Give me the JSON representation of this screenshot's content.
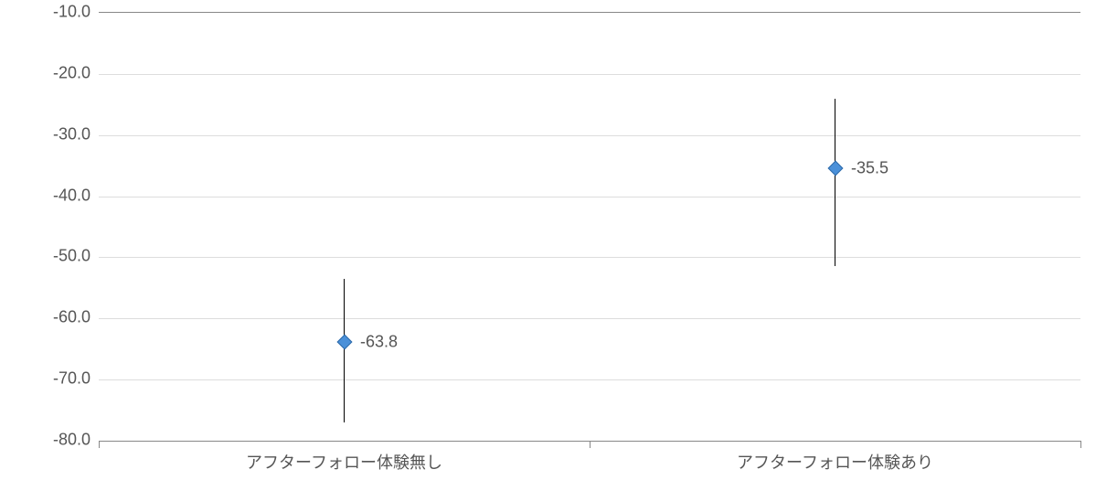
{
  "chart_data": {
    "type": "scatter",
    "categories": [
      "アフターフォロー体験無し",
      "アフターフォロー体験あり"
    ],
    "values": [
      -63.8,
      -35.5
    ],
    "errors": [
      {
        "low": -77.0,
        "high": -53.5
      },
      {
        "low": -51.5,
        "high": -24.0
      }
    ],
    "ylim": [
      -80.0,
      -10.0
    ],
    "yticks": [
      -10.0,
      -20.0,
      -30.0,
      -40.0,
      -50.0,
      -60.0,
      -70.0,
      -80.0
    ],
    "ytick_labels": [
      "-10.0",
      "-20.0",
      "-30.0",
      "-40.0",
      "-50.0",
      "-60.0",
      "-70.0",
      "-80.0"
    ],
    "data_labels": [
      "-63.8",
      "-35.5"
    ],
    "marker_color": "#4a90d9",
    "title": "",
    "xlabel": "",
    "ylabel": ""
  }
}
